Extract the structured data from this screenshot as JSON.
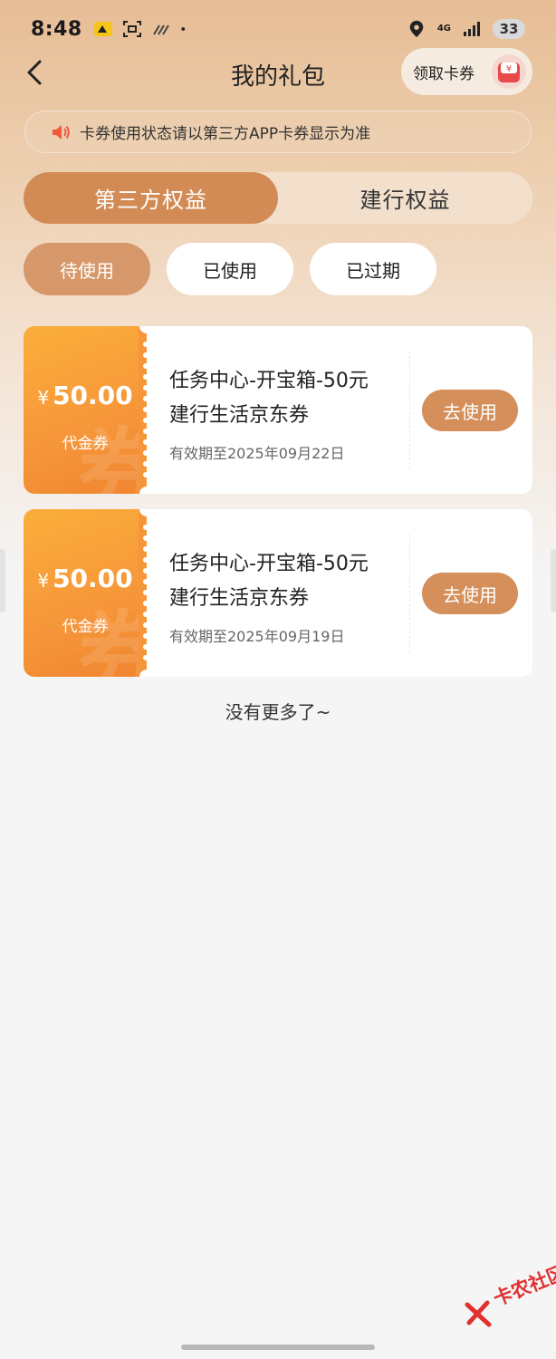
{
  "status_bar": {
    "time": "8:48",
    "network": "4G",
    "battery": "33"
  },
  "nav": {
    "title": "我的礼包",
    "get_coupon_label": "领取卡券",
    "gift_symbol": "¥"
  },
  "notice": {
    "text": "卡券使用状态请以第三方APP卡券显示为准"
  },
  "main_tabs": [
    {
      "label": "第三方权益",
      "active": true
    },
    {
      "label": "建行权益",
      "active": false
    }
  ],
  "sub_tabs": [
    {
      "label": "待使用",
      "active": true
    },
    {
      "label": "已使用",
      "active": false
    },
    {
      "label": "已过期",
      "active": false
    }
  ],
  "coupons": [
    {
      "yen": "¥",
      "amount": "50.00",
      "type": "代金券",
      "name_line1": "任务中心-开宝箱-50元",
      "name_line2": "建行生活京东券",
      "expiry": "有效期至2025年09月22日",
      "action": "去使用"
    },
    {
      "yen": "¥",
      "amount": "50.00",
      "type": "代金券",
      "name_line1": "任务中心-开宝箱-50元",
      "name_line2": "建行生活京东券",
      "expiry": "有效期至2025年09月19日",
      "action": "去使用"
    }
  ],
  "footer": {
    "no_more": "没有更多了~"
  },
  "watermark": {
    "text": "卡农社区"
  },
  "colors": {
    "accent": "#d28b55",
    "coupon_orange": "#f6963a",
    "use_button": "#d48f5b"
  }
}
